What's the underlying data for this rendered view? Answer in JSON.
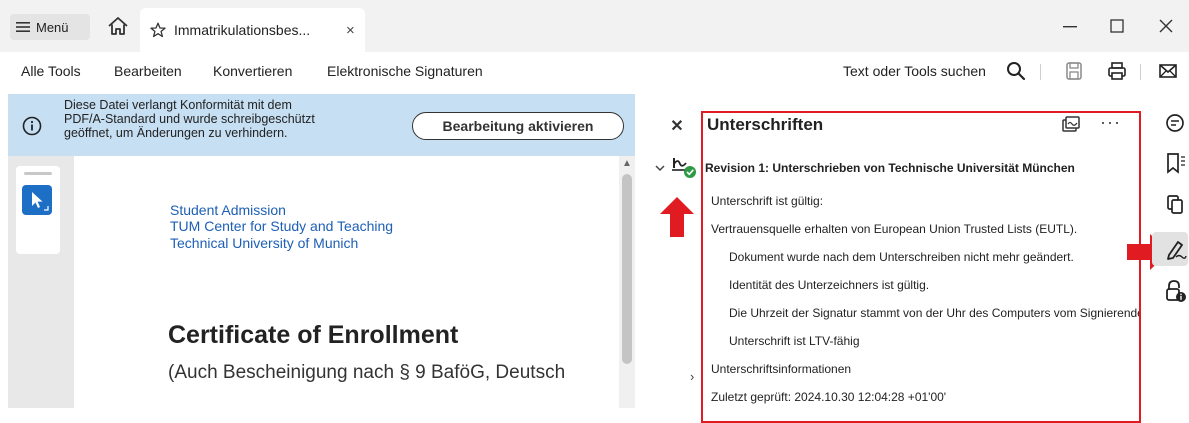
{
  "titlebar": {
    "menu_label": "Menü",
    "tab_title": "Immatrikulationsbes...",
    "tab_close": "×",
    "icons": [
      "hamburger-icon",
      "home-icon",
      "star-icon",
      "minimize-icon",
      "maximize-icon",
      "close-icon"
    ]
  },
  "toolbar": {
    "items": [
      "Alle Tools",
      "Bearbeiten",
      "Konvertieren",
      "Elektronische Signaturen"
    ],
    "search_label": "Text oder Tools suchen",
    "icons": [
      "search-icon",
      "save-icon",
      "print-icon",
      "mail-icon"
    ]
  },
  "banner": {
    "lines": [
      "Diese Datei verlangt Konformität mit dem",
      "PDF/A-Standard und wurde schreibgeschützt",
      "geöffnet, um Änderungen zu verhindern."
    ],
    "button_label": "Bearbeitung aktivieren"
  },
  "document": {
    "address_lines": [
      "Student Admission",
      "TUM Center for Study and Teaching",
      "Technical University of Munich"
    ],
    "title": "Certificate of Enrollment",
    "subtitle": "(Auch Bescheinigung nach § 9 BaföG, Deutsch"
  },
  "signatures_panel": {
    "title": "Unterschriften",
    "more": "···",
    "revision_title": "Revision 1: Unterschrieben von Technische Universität München",
    "status_lines": [
      "Unterschrift ist gültig:",
      "Vertrauensquelle erhalten von European Union Trusted Lists (EUTL)."
    ],
    "detail_lines": [
      "Dokument wurde nach dem Unterschreiben nicht mehr geändert.",
      "Identität des Unterzeichners ist gültig.",
      "Die Uhrzeit der Signatur stammt von der Uhr des Computers vom Signierenden.",
      "Unterschrift ist LTV-fähig"
    ],
    "info_label": "Unterschriftsinformationen",
    "last_checked": "Zuletzt geprüft: 2024.10.30 12:04:28 +01'00'"
  },
  "colors": {
    "accent_blue": "#1d6ec5",
    "banner_bg": "#c6dff3",
    "highlight_red": "#e11b22",
    "valid_green": "#2e9a44",
    "link_blue": "#1d5fb5"
  }
}
